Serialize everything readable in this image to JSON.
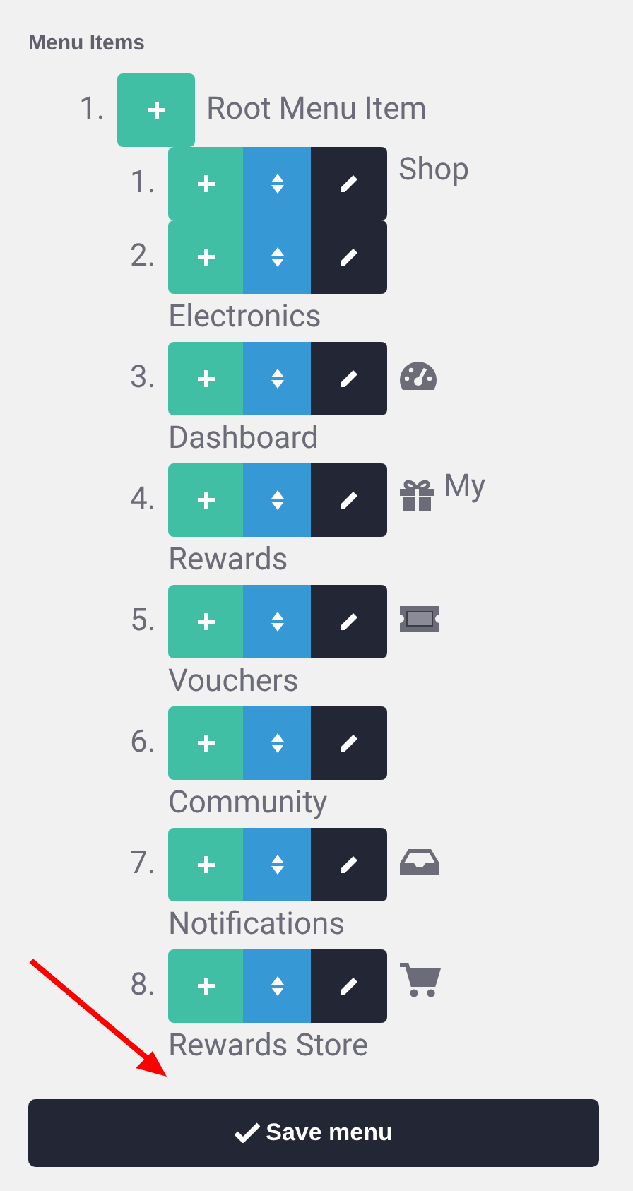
{
  "heading": "Menu Items",
  "root": {
    "number": "1.",
    "label": "Root Menu Item",
    "children": [
      {
        "number": "1.",
        "kind": "plain",
        "label_parts": [
          "Shop"
        ]
      },
      {
        "number": "2.",
        "kind": "plain",
        "label_parts": [
          "Electronics"
        ]
      },
      {
        "number": "3.",
        "kind": "dashboard",
        "label_parts": [
          "Dashboard"
        ]
      },
      {
        "number": "4.",
        "kind": "gift",
        "label_parts": [
          "My",
          "Rewards"
        ]
      },
      {
        "number": "5.",
        "kind": "ticket",
        "label_parts": [
          "Vouchers"
        ]
      },
      {
        "number": "6.",
        "kind": "plain",
        "label_parts": [
          "Community"
        ]
      },
      {
        "number": "7.",
        "kind": "inbox",
        "label_parts": [
          "Notifications"
        ]
      },
      {
        "number": "8.",
        "kind": "cart",
        "label_parts": [
          "Rewards Store"
        ]
      }
    ]
  },
  "save_button": "Save menu",
  "annotation": {
    "kind": "arrow"
  }
}
